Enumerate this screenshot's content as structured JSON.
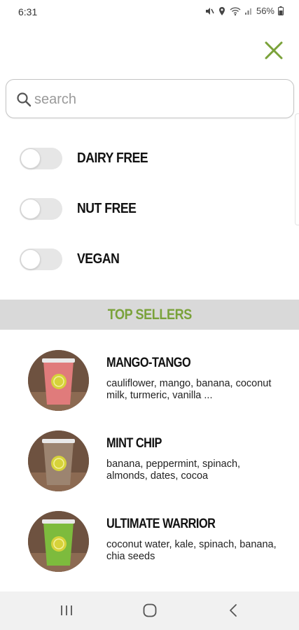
{
  "status_bar": {
    "time": "6:31",
    "battery": "56%"
  },
  "search": {
    "placeholder": "search",
    "value": ""
  },
  "filters": [
    {
      "label": "DAIRY FREE",
      "enabled": false
    },
    {
      "label": "NUT FREE",
      "enabled": false
    },
    {
      "label": "VEGAN",
      "enabled": false
    }
  ],
  "section": {
    "title": "TOP SELLERS"
  },
  "products": [
    {
      "name": "MANGO-TANGO",
      "description": "cauliflower, mango, banana, coconut milk, turmeric, vanilla ...",
      "cup_color": "#e07b7b"
    },
    {
      "name": "MINT CHIP",
      "description": "banana, peppermint, spinach, almonds, dates, cocoa",
      "cup_color": "#9c8470"
    },
    {
      "name": "ULTIMATE WARRIOR",
      "description": "coconut water, kale, spinach, banana, chia seeds",
      "cup_color": "#7dbb3d"
    }
  ],
  "colors": {
    "accent": "#7aa23a",
    "section_bg": "#d9d9d9",
    "toggle_off": "#e6e6e6"
  },
  "icons": {
    "close": "close-x-icon",
    "search": "search-icon",
    "nav": [
      "recent-apps-icon",
      "home-icon",
      "back-icon"
    ]
  }
}
